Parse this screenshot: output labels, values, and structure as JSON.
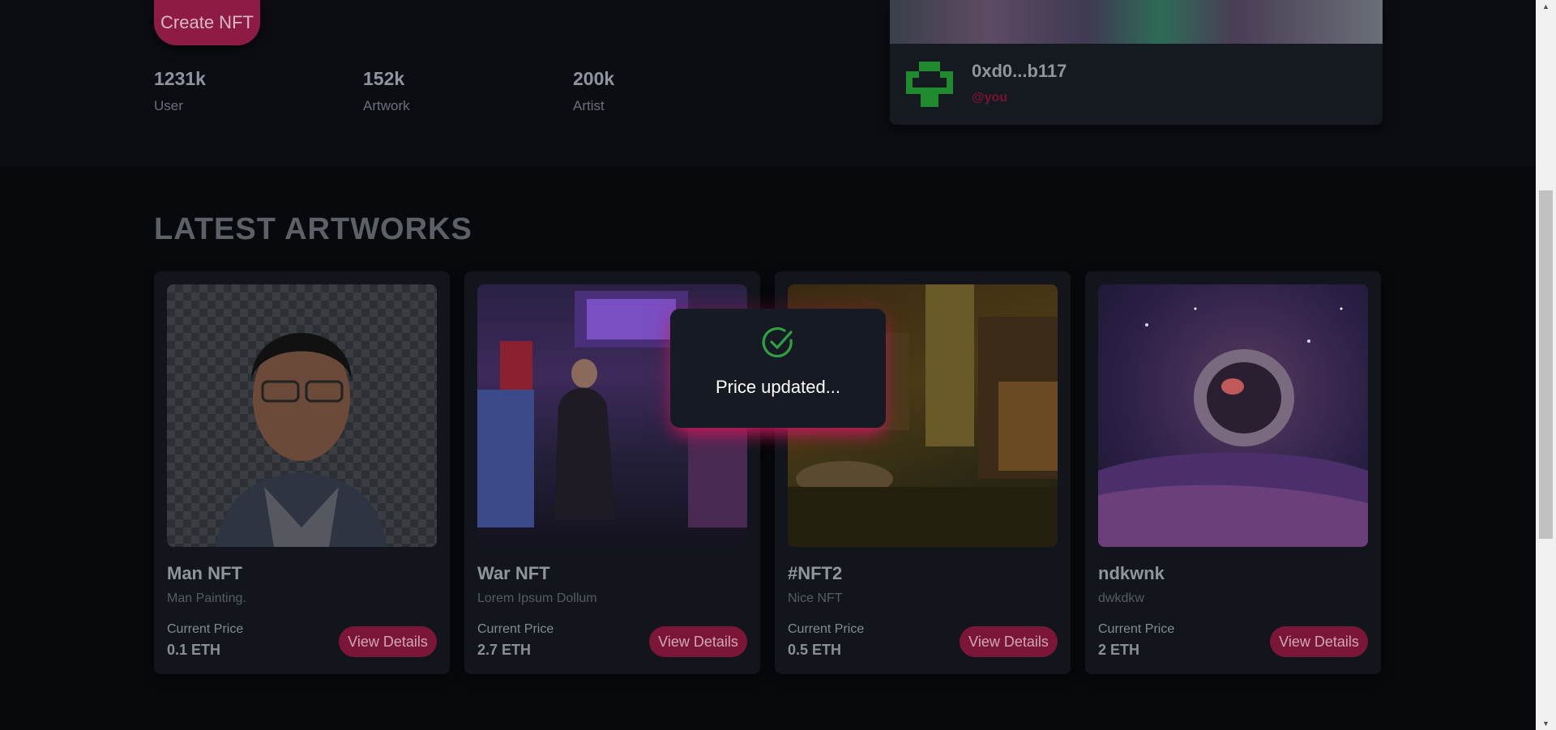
{
  "hero": {
    "create_button": "Create NFT",
    "stats": [
      {
        "value": "1231k",
        "label": "User"
      },
      {
        "value": "152k",
        "label": "Artwork"
      },
      {
        "value": "200k",
        "label": "Artist"
      }
    ]
  },
  "creator_card": {
    "address": "0xd0...b117",
    "handle": "@you"
  },
  "latest": {
    "title": "LATEST ARTWORKS",
    "price_label": "Current Price",
    "button_label": "View Details",
    "items": [
      {
        "name": "Man NFT",
        "description": "Man Painting.",
        "price": "0.1 ETH"
      },
      {
        "name": "War NFT",
        "description": "Lorem Ipsum Dollum",
        "price": "2.7 ETH"
      },
      {
        "name": "#NFT2",
        "description": "Nice NFT",
        "price": "0.5 ETH"
      },
      {
        "name": "ndkwnk",
        "description": "dwkdkw",
        "price": "2 ETH"
      }
    ]
  },
  "toast": {
    "message": "Price updated...",
    "icon": "check-circle-icon",
    "accent": "#c2185b"
  },
  "colors": {
    "primary": "#8e1a46",
    "background": "#0b0d12",
    "card": "#12161c",
    "success": "#2ea043"
  }
}
